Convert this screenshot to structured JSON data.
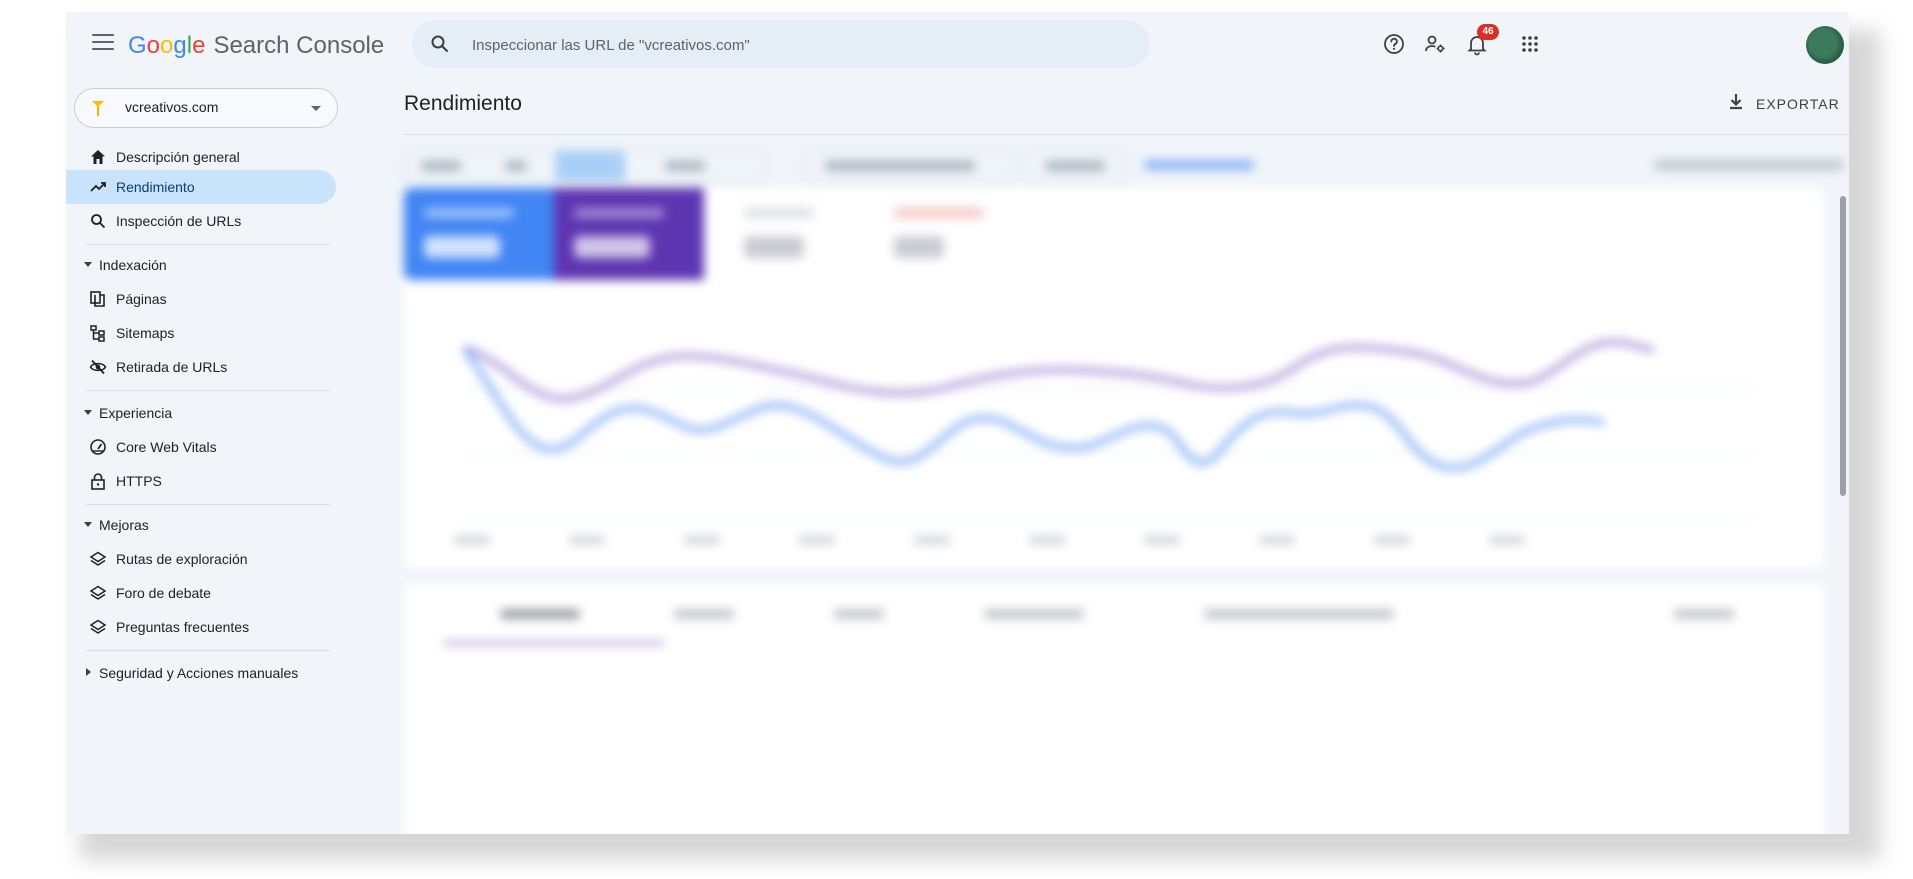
{
  "header": {
    "menu_icon": "hamburger-menu-icon",
    "logo_letters": [
      "G",
      "o",
      "o",
      "g",
      "l",
      "e"
    ],
    "product_name": "Search Console",
    "search_placeholder": "Inspeccionar las URL de \"vcreativos.com\"",
    "help_icon": "help-circle-icon",
    "users_icon": "manage-users-icon",
    "notifications_icon": "notifications-bell-icon",
    "notifications_count": "46",
    "apps_icon": "apps-grid-icon"
  },
  "property": {
    "name": "vcreativos.com"
  },
  "sidebar": {
    "items": [
      {
        "label": "Descripción general",
        "icon": "home-icon"
      },
      {
        "label": "Rendimiento",
        "icon": "trending-up-icon",
        "active": true
      },
      {
        "label": "Inspección de URLs",
        "icon": "search-icon"
      }
    ],
    "sections": [
      {
        "title": "Indexación",
        "expanded": true,
        "items": [
          {
            "label": "Páginas",
            "icon": "pages-icon"
          },
          {
            "label": "Sitemaps",
            "icon": "sitemap-icon"
          },
          {
            "label": "Retirada de URLs",
            "icon": "eye-off-icon"
          }
        ]
      },
      {
        "title": "Experiencia",
        "expanded": true,
        "items": [
          {
            "label": "Core Web Vitals",
            "icon": "speedometer-icon"
          },
          {
            "label": "HTTPS",
            "icon": "lock-icon"
          }
        ]
      },
      {
        "title": "Mejoras",
        "expanded": true,
        "items": [
          {
            "label": "Rutas de exploración",
            "icon": "layers-icon"
          },
          {
            "label": "Foro de debate",
            "icon": "layers-icon"
          },
          {
            "label": "Preguntas frecuentes",
            "icon": "layers-icon"
          }
        ]
      },
      {
        "title": "Seguridad y Acciones manuales",
        "expanded": false,
        "items": []
      }
    ]
  },
  "main": {
    "title": "Rendimiento",
    "export_label": "EXPORTAR",
    "export_icon": "download-icon"
  },
  "colors": {
    "clicks_series": "#4285f4",
    "impressions_series": "#5e35b1",
    "active_nav": "#c9e3fb",
    "notification_badge": "#d93025"
  }
}
